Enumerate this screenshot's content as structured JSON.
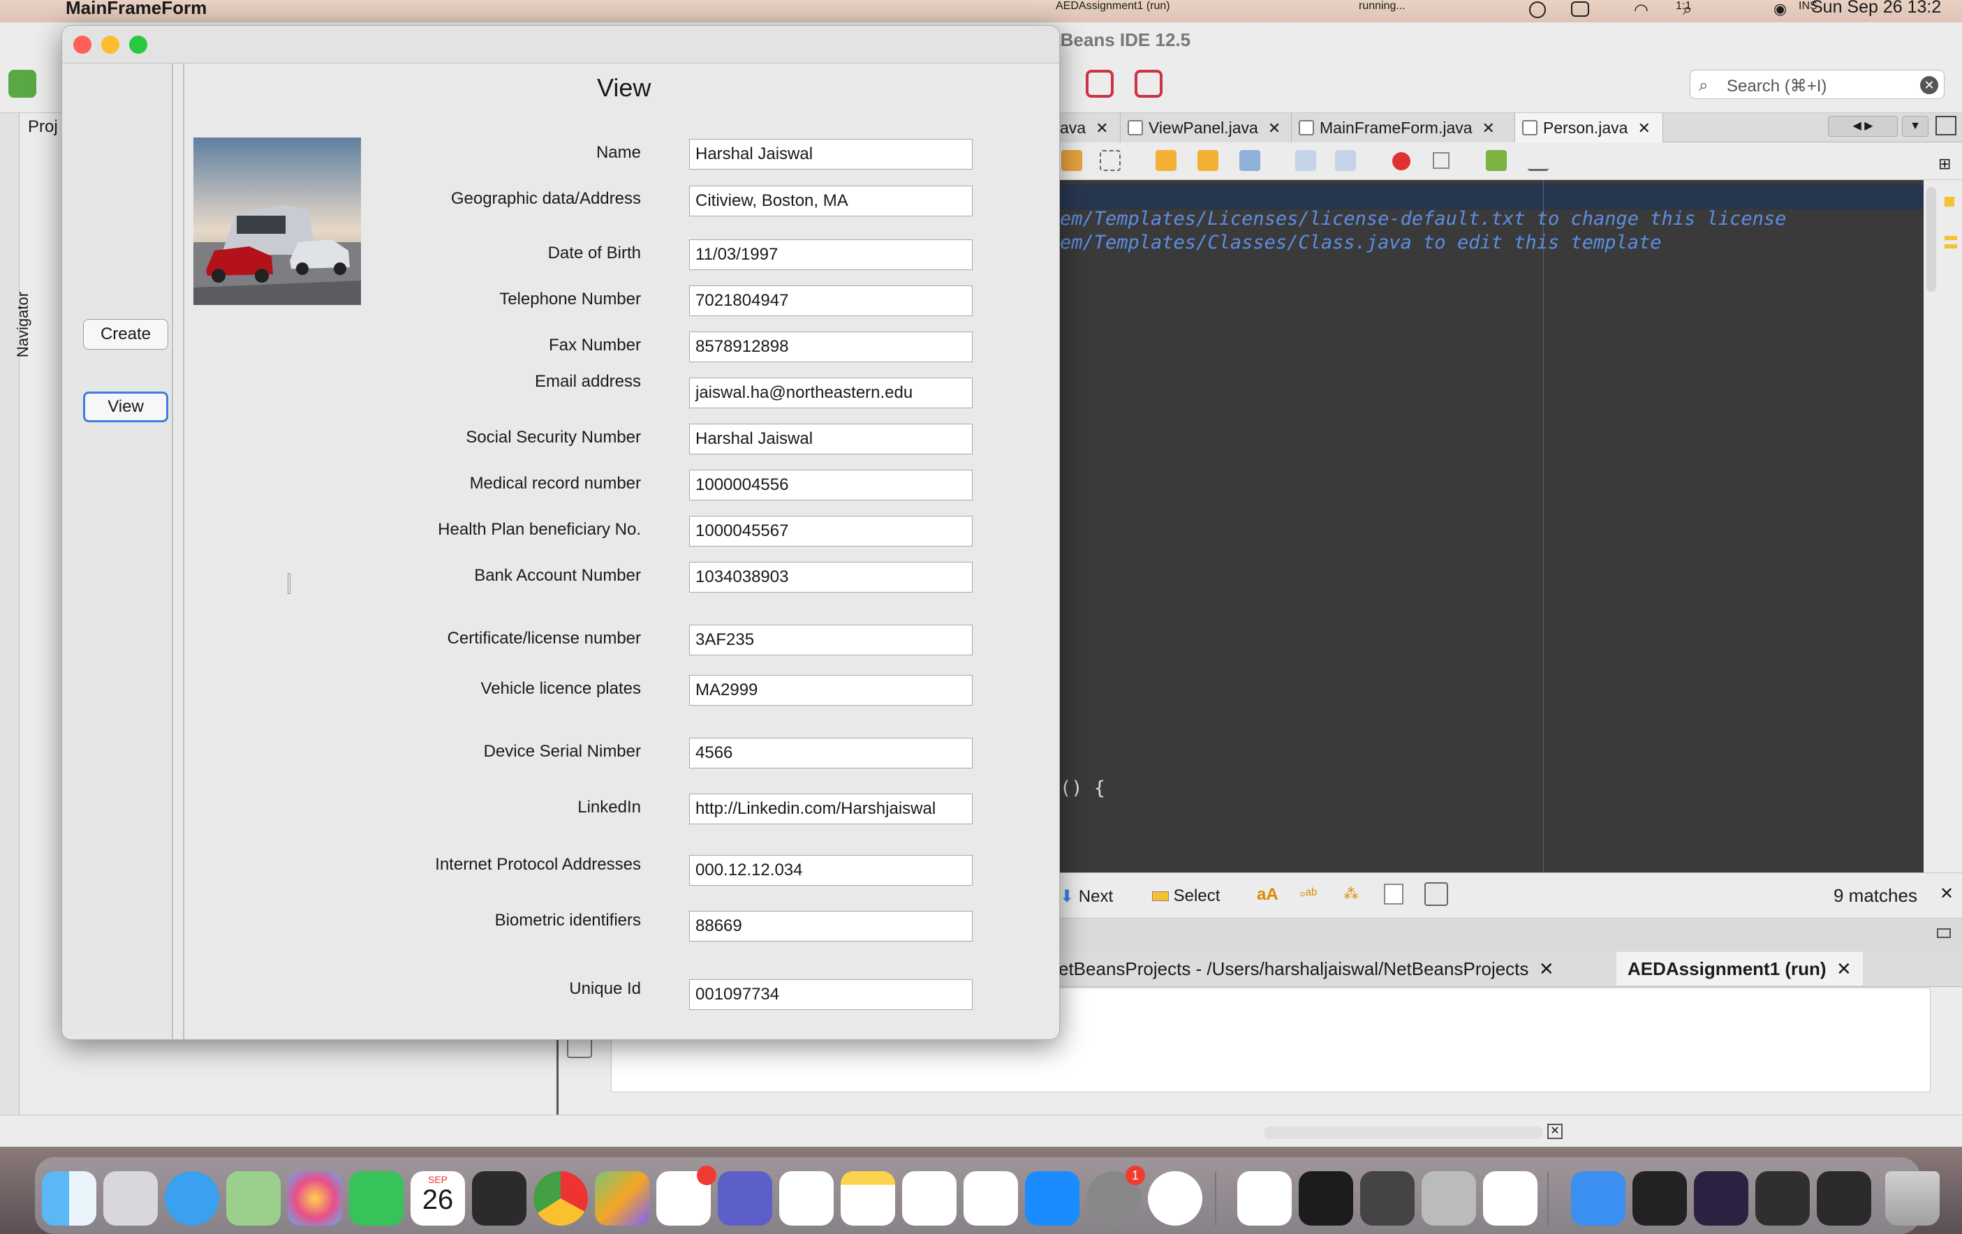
{
  "menubar": {
    "app_name": "MainFrameForm",
    "clock": "Sun Sep 26  13:2"
  },
  "ide": {
    "title": "tBeans IDE 12.5",
    "search_placeholder": "Search (⌘+I)",
    "left_tab": "Proj",
    "navigator_label": "Navigator",
    "tabs": [
      "ava",
      "ViewPanel.java",
      "MainFrameForm.java",
      "Person.java"
    ],
    "code_lines": [
      "em/Templates/Licenses/license-default.txt to change this license",
      "em/Templates/Classes/Class.java to edit this template",
      "() {"
    ],
    "find": {
      "next": "Next",
      "select": "Select",
      "matches": "9 matches"
    },
    "output_tabs": [
      "etBeansProjects - /Users/harshaljaiswal/NetBeansProjects",
      "AEDAssignment1 (run)"
    ],
    "status": {
      "project": "AEDAssignment1 (run)",
      "state": "running...",
      "position": "1:1",
      "mode": "INS"
    }
  },
  "dialog": {
    "title": "View",
    "buttons": {
      "create": "Create",
      "view": "View"
    },
    "fields": [
      {
        "label": "Name",
        "value": "Harshal Jaiswal"
      },
      {
        "label": "Geographic data/Address",
        "value": "Citiview, Boston, MA"
      },
      {
        "label": "Date of Birth",
        "value": "11/03/1997"
      },
      {
        "label": "Telephone Number",
        "value": "7021804947"
      },
      {
        "label": "Fax Number",
        "value": "8578912898"
      },
      {
        "label": "Email address",
        "value": "jaiswal.ha@northeastern.edu"
      },
      {
        "label": "Social Security Number",
        "value": "Harshal Jaiswal"
      },
      {
        "label": "Medical record number",
        "value": "1000004556"
      },
      {
        "label": "Health Plan beneficiary No.",
        "value": "1000045567"
      },
      {
        "label": "Bank Account Number",
        "value": "1034038903"
      },
      {
        "label": "Certificate/license number",
        "value": "3AF235"
      },
      {
        "label": "Vehicle licence plates",
        "value": "MA2999"
      },
      {
        "label": "Device Serial Nimber",
        "value": "4566"
      },
      {
        "label": "LinkedIn",
        "value": "http://Linkedin.com/Harshjaiswal"
      },
      {
        "label": "Internet Protocol Addresses",
        "value": "000.12.12.034"
      },
      {
        "label": "Biometric identifiers",
        "value": "88669"
      },
      {
        "label": "Unique Id",
        "value": "001097734"
      }
    ]
  },
  "dock": {
    "calendar_month": "SEP",
    "calendar_day": "26",
    "badge_slack": "",
    "badge_settings": "1"
  }
}
